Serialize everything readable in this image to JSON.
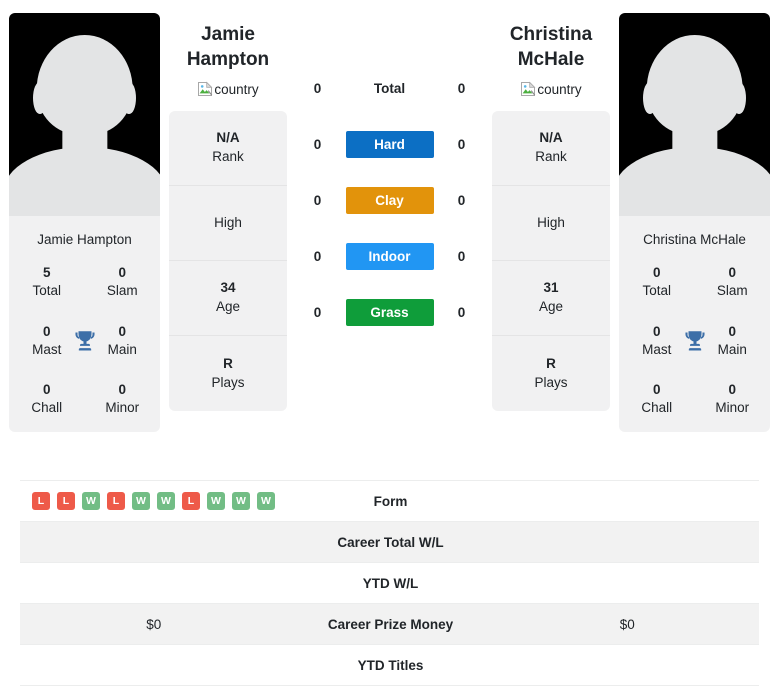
{
  "players": {
    "left": {
      "name_line1": "Jamie",
      "name_line2": "Hampton",
      "country_alt": "country",
      "avatar_alt": "player photo",
      "titles_name": "Jamie Hampton",
      "titles": [
        {
          "num": "5",
          "label": "Total"
        },
        {
          "num": "0",
          "label": "Slam"
        },
        {
          "num": "0",
          "label": "Mast"
        },
        {
          "num": "0",
          "label": "Main"
        },
        {
          "num": "0",
          "label": "Chall"
        },
        {
          "num": "0",
          "label": "Minor"
        }
      ],
      "info": [
        {
          "value": "N/A",
          "label": "Rank"
        },
        {
          "value": "",
          "label": "High"
        },
        {
          "value": "34",
          "label": "Age"
        },
        {
          "value": "R",
          "label": "Plays"
        }
      ]
    },
    "right": {
      "name_line1": "Christina",
      "name_line2": "McHale",
      "country_alt": "country",
      "avatar_alt": "player photo",
      "titles_name": "Christina McHale",
      "titles": [
        {
          "num": "0",
          "label": "Total"
        },
        {
          "num": "0",
          "label": "Slam"
        },
        {
          "num": "0",
          "label": "Mast"
        },
        {
          "num": "0",
          "label": "Main"
        },
        {
          "num": "0",
          "label": "Chall"
        },
        {
          "num": "0",
          "label": "Minor"
        }
      ],
      "info": [
        {
          "value": "N/A",
          "label": "Rank"
        },
        {
          "value": "",
          "label": "High"
        },
        {
          "value": "31",
          "label": "Age"
        },
        {
          "value": "R",
          "label": "Plays"
        }
      ]
    }
  },
  "surfaces": [
    {
      "label": "Total",
      "left": "0",
      "right": "0",
      "color": "",
      "filled": false
    },
    {
      "label": "Hard",
      "left": "0",
      "right": "0",
      "color": "#0c6fc4",
      "filled": true
    },
    {
      "label": "Clay",
      "left": "0",
      "right": "0",
      "color": "#e2930b",
      "filled": true
    },
    {
      "label": "Indoor",
      "left": "0",
      "right": "0",
      "color": "#2196f3",
      "filled": true
    },
    {
      "label": "Grass",
      "left": "0",
      "right": "0",
      "color": "#0f9d3a",
      "filled": true
    }
  ],
  "form": {
    "left": [
      "L",
      "L",
      "W",
      "L",
      "W",
      "W",
      "L",
      "W",
      "W",
      "W"
    ],
    "right": [],
    "win_color": "#72bd85",
    "loss_color": "#ee5a49"
  },
  "stat_rows": [
    {
      "label": "Form",
      "left": "",
      "right": "",
      "striped": false,
      "form": true
    },
    {
      "label": "Career Total W/L",
      "left": "",
      "right": "",
      "striped": true,
      "form": false
    },
    {
      "label": "YTD W/L",
      "left": "",
      "right": "",
      "striped": false,
      "form": false
    },
    {
      "label": "Career Prize Money",
      "left": "$0",
      "right": "$0",
      "striped": true,
      "form": false
    },
    {
      "label": "YTD Titles",
      "left": "",
      "right": "",
      "striped": false,
      "form": false
    }
  ]
}
